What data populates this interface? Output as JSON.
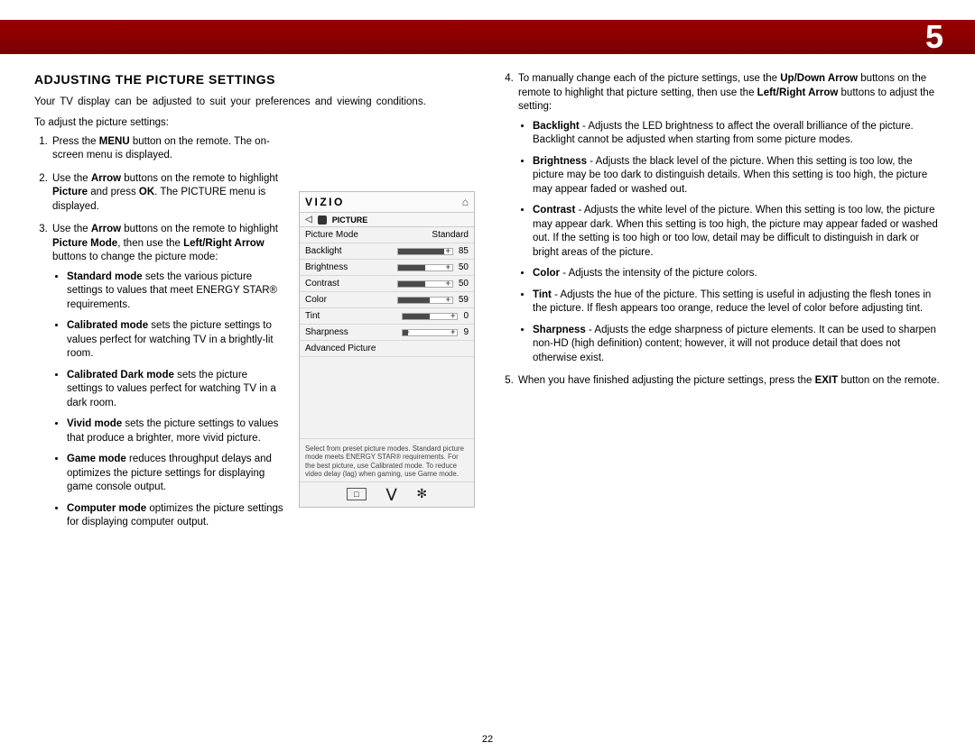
{
  "chapter": "5",
  "pageNumber": "22",
  "section_title": "ADJUSTING THE PICTURE SETTINGS",
  "intro": "Your TV display can be adjusted to suit your preferences and viewing conditions.",
  "lead": "To adjust the picture settings:",
  "step1": {
    "a": "Press the ",
    "b": "MENU",
    "c": " button on the remote. The on-screen menu is displayed."
  },
  "step2": {
    "a": "Use the ",
    "b": "Arrow",
    "c": " buttons on the remote to highlight ",
    "d": "Picture",
    "e": " and press ",
    "f": "OK",
    "g": ". The PICTURE menu is displayed."
  },
  "step3": {
    "a": "Use the ",
    "b": "Arrow",
    "c": " buttons on the remote to highlight ",
    "d": "Picture Mode",
    "e": ", then use the ",
    "f": "Left/Right Arrow",
    "g": " buttons to change the picture mode:"
  },
  "mode_std": {
    "b": "Standard mode",
    "t": " sets the various picture settings to values that meet ENERGY STAR® requirements."
  },
  "mode_cal": {
    "b": "Calibrated mode",
    "t": " sets the picture settings to values perfect for watching TV in a brightly-lit room."
  },
  "mode_caldark": {
    "b": "Calibrated Dark mode",
    "t": " sets the picture settings to values perfect for watching TV in a dark room."
  },
  "mode_vivid": {
    "b": "Vivid mode",
    "t": " sets the picture settings to values that produce a brighter, more vivid picture."
  },
  "mode_game": {
    "b": "Game mode",
    "t": " reduces throughput delays and optimizes the picture settings for displaying game console output."
  },
  "mode_comp": {
    "b": "Computer mode",
    "t": " optimizes the picture settings for displaying computer output."
  },
  "step4": {
    "a": "To manually change each of the picture settings, use the ",
    "b": "Up/Down Arrow",
    "c": " buttons on the remote to highlight that picture setting, then use the ",
    "d": "Left/Right Arrow",
    "e": " buttons to adjust the setting:"
  },
  "adj_backlight": {
    "b": "Backlight",
    "t": " - Adjusts the LED brightness to affect the overall brilliance of the picture. Backlight cannot be adjusted when starting from some picture modes."
  },
  "adj_brightness": {
    "b": "Brightness",
    "t": " - Adjusts the black level of the picture. When this setting is too low, the picture may be too dark to distinguish details. When this setting is too high, the picture may appear faded or washed out."
  },
  "adj_contrast": {
    "b": "Contrast",
    "t": " - Adjusts the white level of the picture. When this setting is too low, the picture may appear dark. When this setting is too high, the picture may appear faded or washed out. If the setting is too high or too low, detail may be difficult to distinguish in dark or bright areas of the picture."
  },
  "adj_color": {
    "b": "Color",
    "t": " - Adjusts the intensity of the picture colors."
  },
  "adj_tint": {
    "b": "Tint",
    "t": " - Adjusts the hue of the picture. This setting is useful in adjusting the flesh tones in the picture. If flesh appears too orange, reduce the level of color before adjusting tint."
  },
  "adj_sharpness": {
    "b": "Sharpness",
    "t": " - Adjusts the edge sharpness of picture elements. It can be used to sharpen non-HD (high definition) content; however, it will not produce detail that does not otherwise exist."
  },
  "step5": {
    "a": "When you have finished adjusting the picture settings, press the ",
    "b": "EXIT",
    "c": " button on the remote."
  },
  "osd": {
    "brand": "VIZIO",
    "title": "PICTURE",
    "rows": {
      "picture_mode_label": "Picture Mode",
      "picture_mode_value": "Standard",
      "backlight_label": "Backlight",
      "backlight_value": "85",
      "brightness_label": "Brightness",
      "brightness_value": "50",
      "contrast_label": "Contrast",
      "contrast_value": "50",
      "color_label": "Color",
      "color_value": "59",
      "tint_label": "Tint",
      "tint_value": "0",
      "sharpness_label": "Sharpness",
      "sharpness_value": "9",
      "advanced_label": "Advanced Picture"
    },
    "hint": "Select from preset picture modes. Standard picture mode meets ENERGY STAR® requirements. For the best picture, use Calibrated mode. To reduce video delay (lag) when gaming, use Game mode.",
    "square_glyph": "□"
  }
}
